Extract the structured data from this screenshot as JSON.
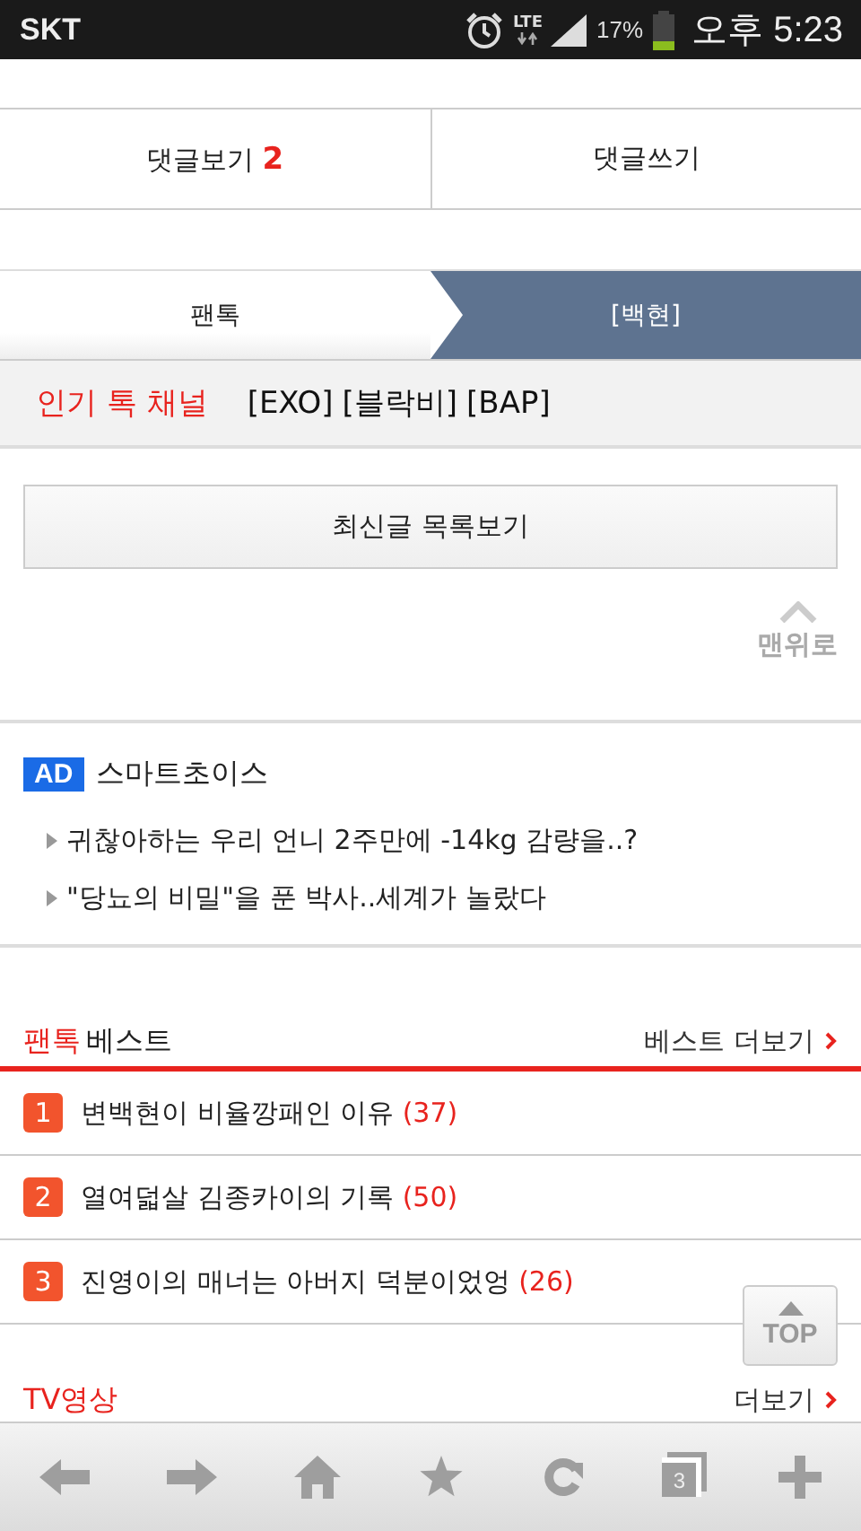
{
  "status_bar": {
    "carrier": "SKT",
    "network": "LTE",
    "battery": "17%",
    "time": "오후 5:23"
  },
  "comment_buttons": [
    {
      "label": "댓글보기",
      "count": "2"
    },
    {
      "label": "댓글쓰기"
    }
  ],
  "tabs": [
    {
      "label": "팬톡",
      "selected": false
    },
    {
      "label": "[백현]",
      "selected": true
    }
  ],
  "popular_channels": {
    "title": "인기 톡 채널",
    "items": [
      "[EXO]",
      "[블락비]",
      "[BAP]"
    ]
  },
  "latest_button": "최신글 목록보기",
  "to_top_link": "맨위로",
  "ad": {
    "badge": "AD",
    "title": "스마트초이스",
    "items": [
      "귀찮아하는 우리 언니 2주만에 -14kg 감량을..?",
      "\"당뇨의 비밀\"을 푼 박사..세계가 놀랐다"
    ]
  },
  "best": {
    "title_accent": "팬톡",
    "title": "베스트",
    "more": "베스트 더보기",
    "items": [
      {
        "rank": "1",
        "title": "변백현이 비율깡패인 이유",
        "count": "(37)"
      },
      {
        "rank": "2",
        "title": "열여덟살 김종카이의 기록",
        "count": "(50)"
      },
      {
        "rank": "3",
        "title": "진영이의 매너는 아버지 덕분이었엉",
        "count": "(26)"
      }
    ]
  },
  "tv": {
    "title": "TV영상",
    "more": "더보기"
  },
  "top_button": "TOP",
  "toolbar": {
    "tab_count": "3"
  }
}
